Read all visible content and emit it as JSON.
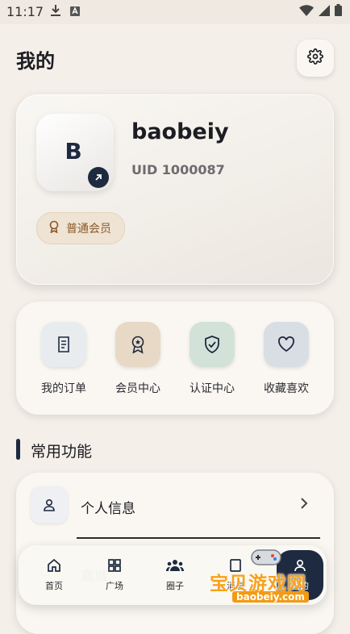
{
  "status_bar": {
    "time": "11:17"
  },
  "header": {
    "title": "我的"
  },
  "profile": {
    "avatar_letter": "B",
    "username": "baobeiy",
    "uid": "UID 1000087",
    "member_level": "普通会员"
  },
  "quick_actions": [
    {
      "label": "我的订单",
      "icon": "receipt-icon",
      "bg": "#e9ecef"
    },
    {
      "label": "会员中心",
      "icon": "badge-icon",
      "bg": "#e7d9c6"
    },
    {
      "label": "认证中心",
      "icon": "shield-check-icon",
      "bg": "#d3e2d9"
    },
    {
      "label": "收藏喜欢",
      "icon": "heart-icon",
      "bg": "#d9dde4"
    }
  ],
  "section": {
    "title": "常用功能"
  },
  "functions": [
    {
      "label": "个人信息",
      "icon": "user-icon"
    },
    {
      "label": "商城",
      "icon": "store-icon"
    }
  ],
  "bottom_nav": [
    {
      "label": "首页",
      "icon": "home-icon"
    },
    {
      "label": "广场",
      "icon": "grid-icon"
    },
    {
      "label": "圈子",
      "icon": "group-icon"
    },
    {
      "label": "消息",
      "icon": "message-icon"
    },
    {
      "label": "我的",
      "icon": "profile-icon",
      "active": true
    }
  ],
  "watermark": {
    "text": "宝贝游戏网",
    "url": "baobeiy.com"
  },
  "colors": {
    "accent": "#1d2a40",
    "background": "#f4efe8",
    "member": "#8a5a2c",
    "watermark": "#f7a11c"
  }
}
